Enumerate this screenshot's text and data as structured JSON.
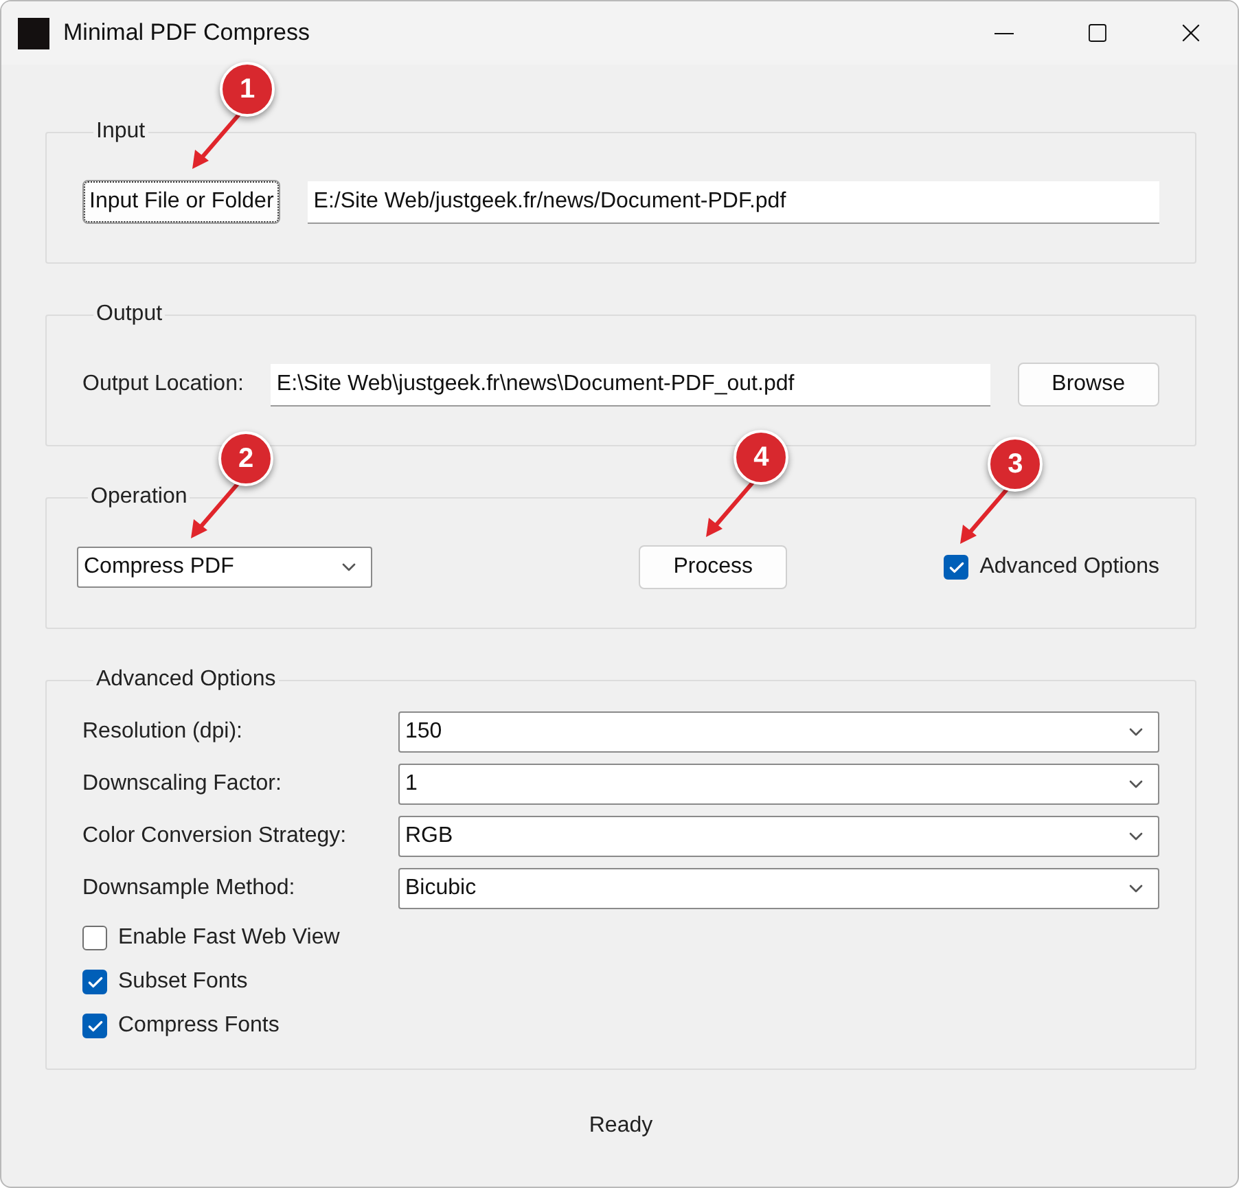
{
  "window": {
    "title": "Minimal PDF Compress"
  },
  "input": {
    "legend": "Input",
    "button": "Input File or Folder",
    "value": "E:/Site Web/justgeek.fr/news/Document-PDF.pdf",
    "callout": "1"
  },
  "output": {
    "legend": "Output",
    "label": "Output Location:",
    "value": "E:\\Site Web\\justgeek.fr\\news\\Document-PDF_out.pdf",
    "button": "Browse"
  },
  "operation": {
    "legend": "Operation",
    "select": "Compress PDF",
    "select_callout": "2",
    "process": "Process",
    "process_callout": "4",
    "advanced": {
      "label": "Advanced Options",
      "checked": true,
      "callout": "3"
    }
  },
  "advanced_options": {
    "legend": "Advanced Options",
    "fields": [
      {
        "label": "Resolution (dpi):",
        "value": "150"
      },
      {
        "label": "Downscaling Factor:",
        "value": "1"
      },
      {
        "label": "Color Conversion Strategy:",
        "value": "RGB"
      },
      {
        "label": "Downsample Method:",
        "value": "Bicubic"
      }
    ],
    "checkboxes": [
      {
        "label": "Enable Fast Web View",
        "checked": false
      },
      {
        "label": "Subset Fonts",
        "checked": true
      },
      {
        "label": "Compress Fonts",
        "checked": true
      }
    ]
  },
  "status": "Ready"
}
